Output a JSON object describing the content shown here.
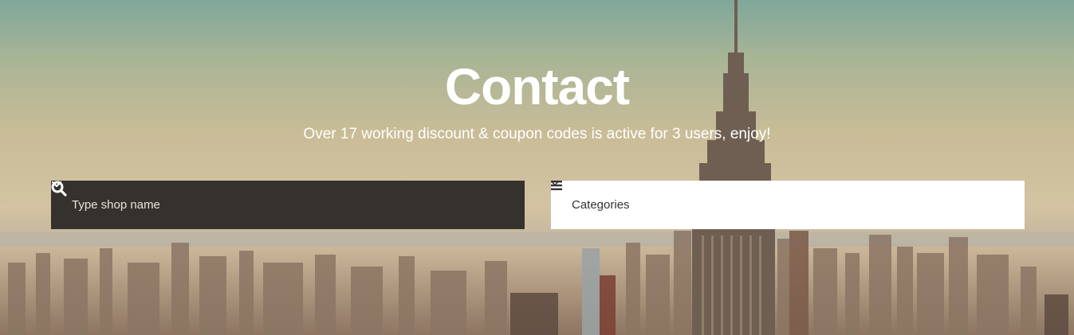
{
  "hero": {
    "title": "Contact",
    "subtitle": "Over 17 working discount & coupon codes is active for 3 users, enjoy!"
  },
  "shop_search": {
    "placeholder": "Type shop name",
    "icon": "search-icon",
    "dropdown_icon": "chevron-down-icon"
  },
  "categories": {
    "label": "Categories",
    "icon": "menu-icon",
    "dropdown_icon": "chevron-down-icon"
  },
  "colors": {
    "search_bg": "#35322e",
    "categories_bg": "#ffffff",
    "text_light": "#ffffff"
  }
}
